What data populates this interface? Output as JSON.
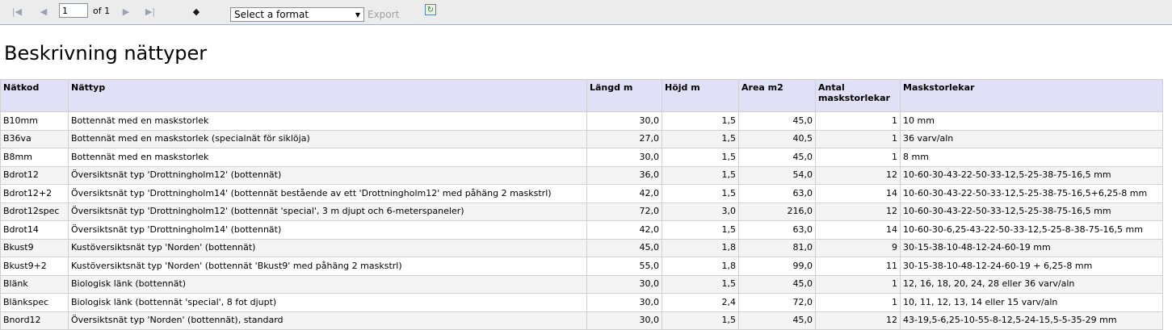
{
  "toolbar": {
    "page_value": "1",
    "page_of": "of 1",
    "format_placeholder": "Select a format",
    "export_label": "Export"
  },
  "title": "Beskrivning nättyper",
  "table": {
    "headers": [
      "Nätkod",
      "Nättyp",
      "Längd m",
      "Höjd m",
      "Area m2",
      "Antal maskstorlekar",
      "Maskstorlekar"
    ],
    "rows": [
      [
        "B10mm",
        "Bottennät med en maskstorlek",
        "30,0",
        "1,5",
        "45,0",
        "1",
        "10 mm"
      ],
      [
        "B36va",
        "Bottennät med en maskstorlek (specialnät för siklöja)",
        "27,0",
        "1,5",
        "40,5",
        "1",
        "36 varv/aln"
      ],
      [
        "B8mm",
        "Bottennät med en maskstorlek",
        "30,0",
        "1,5",
        "45,0",
        "1",
        "8 mm"
      ],
      [
        "Bdrot12",
        "Översiktsnät typ 'Drottningholm12' (bottennät)",
        "36,0",
        "1,5",
        "54,0",
        "12",
        "10-60-30-43-22-50-33-12,5-25-38-75-16,5 mm"
      ],
      [
        "Bdrot12+2",
        "Översiktsnät typ 'Drottningholm14' (bottennät bestående av ett 'Drottningholm12' med påhäng 2 maskstrl)",
        "42,0",
        "1,5",
        "63,0",
        "14",
        "10-60-30-43-22-50-33-12,5-25-38-75-16,5+6,25-8 mm"
      ],
      [
        "Bdrot12spec",
        "Översiktsnät typ 'Drottningholm12' (bottennät 'special', 3 m djupt och 6-meterspaneler)",
        "72,0",
        "3,0",
        "216,0",
        "12",
        "10-60-30-43-22-50-33-12,5-25-38-75-16,5 mm"
      ],
      [
        "Bdrot14",
        "Översiktsnät typ 'Drottningholm14' (bottennät)",
        "42,0",
        "1,5",
        "63,0",
        "14",
        "10-60-30-6,25-43-22-50-33-12,5-25-8-38-75-16,5 mm"
      ],
      [
        "Bkust9",
        "Kustöversiktsnät typ 'Norden' (bottennät)",
        "45,0",
        "1,8",
        "81,0",
        "9",
        "30-15-38-10-48-12-24-60-19 mm"
      ],
      [
        "Bkust9+2",
        "Kustöversiktsnät typ 'Norden' (bottennät 'Bkust9' med påhäng 2 maskstrl)",
        "55,0",
        "1,8",
        "99,0",
        "11",
        "30-15-38-10-48-12-24-60-19 + 6,25-8 mm"
      ],
      [
        "Blänk",
        "Biologisk länk (bottennät)",
        "30,0",
        "1,5",
        "45,0",
        "1",
        "12, 16, 18, 20, 24, 28 eller 36 varv/aln"
      ],
      [
        "Blänkspec",
        "Biologisk länk (bottennät 'special', 8 fot djupt)",
        "30,0",
        "2,4",
        "72,0",
        "1",
        "10, 11, 12, 13, 14 eller 15 varv/aln"
      ],
      [
        "Bnord12",
        "Översiktsnät typ 'Norden' (bottennät), standard",
        "30,0",
        "1,5",
        "45,0",
        "12",
        "43-19,5-6,25-10-55-8-12,5-24-15,5-5-35-29 mm"
      ]
    ]
  }
}
